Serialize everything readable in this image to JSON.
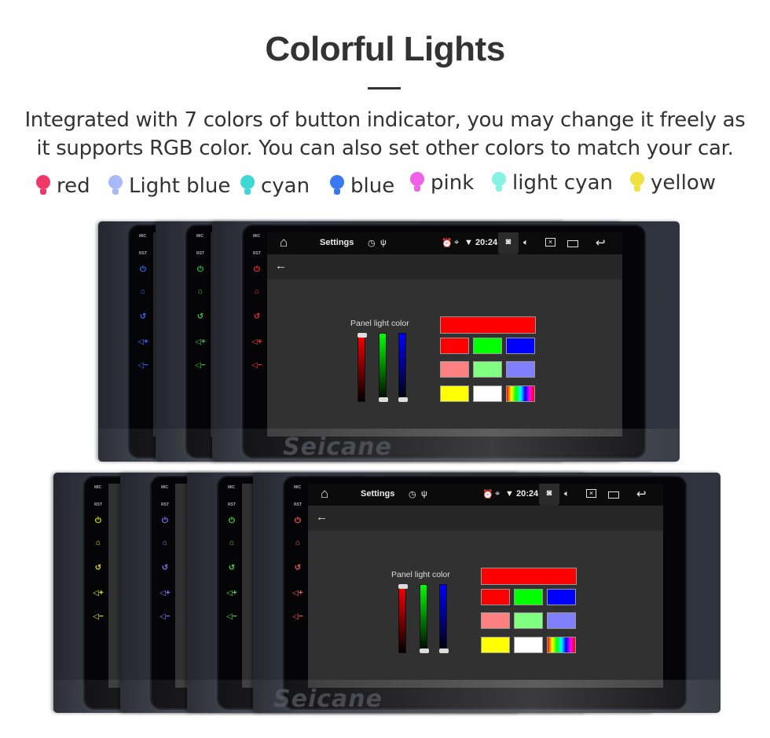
{
  "heading": {
    "title": "Colorful Lights",
    "line1": "Integrated with 7 colors of button indicator, you may change it freely as",
    "line2": "it supports RGB color. You can also set other colors to match your car."
  },
  "legend": [
    {
      "label": "red",
      "color": "#f0386b"
    },
    {
      "label": "Light blue",
      "color": "#a9b9f8"
    },
    {
      "label": "cyan",
      "color": "#3fd6d6"
    },
    {
      "label": "blue",
      "color": "#3a78f0"
    },
    {
      "label": "pink",
      "color": "#f060e8"
    },
    {
      "label": "light cyan",
      "color": "#86f2e2"
    },
    {
      "label": "yellow",
      "color": "#f0e040"
    }
  ],
  "units": {
    "top": {
      "led_colors": [
        "#3a6bff",
        "#2ecc40",
        "#ff3030"
      ]
    },
    "bottom": {
      "led_colors": [
        "#e6e600",
        "#7b7bff",
        "#4cdc4c",
        "#ff5a5a"
      ]
    }
  },
  "bezel_labels": {
    "mic": "MIC",
    "rst": "RST"
  },
  "screen": {
    "app_title": "Settings",
    "time": "20:24",
    "panel_label": "Panel light color",
    "slider_levels": {
      "red": 1.0,
      "green": 0.0,
      "blue": 0.0
    },
    "selected_color": "#ff0000",
    "swatches": [
      "#ff0000",
      "#00ff00",
      "#0000ff",
      "#ff8080",
      "#80ff80",
      "#8080ff",
      "#ffff00",
      "#ffffff",
      "rainbow"
    ],
    "status_icons": [
      "home-icon",
      "timer-icon",
      "usb-icon",
      "alarm-icon",
      "location-icon",
      "wifi-icon",
      "camera-icon",
      "volume-icon",
      "close-app-icon",
      "recent-apps-icon",
      "back-icon"
    ]
  },
  "watermark": "Seicane"
}
